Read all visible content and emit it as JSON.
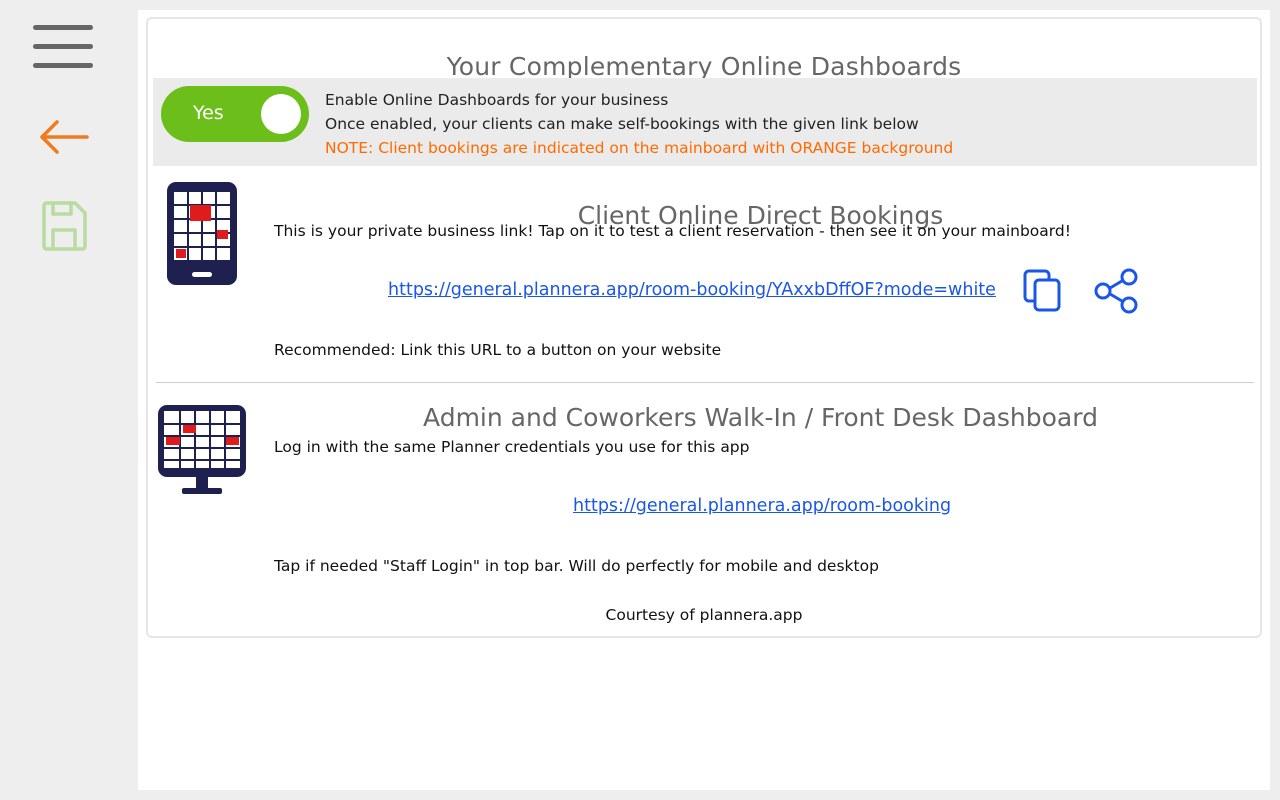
{
  "sidebar": {
    "menu_icon": "hamburger-menu-icon",
    "back_icon": "arrow-left-icon",
    "save_icon": "floppy-disk-icon"
  },
  "page": {
    "title": "Your Complementary Online Dashboards"
  },
  "enable": {
    "toggle_label": "Yes",
    "toggle_on": true,
    "line1": "Enable Online Dashboards for your business",
    "line2": "Once enabled, your clients can make self-bookings with the given link below",
    "note": "NOTE: Client bookings are indicated on the mainboard with ORANGE background"
  },
  "client": {
    "icon": "mobile-calendar-icon",
    "title": "Client Online Direct Bookings",
    "description": "This is your private business link! Tap on it to test a client reservation - then see it on your mainboard!",
    "link": "https://general.plannera.app/room-booking/YAxxbDffOF?mode=white",
    "copy_icon": "copy-icon",
    "share_icon": "share-icon",
    "recommendation": "Recommended: Link this URL to a button on your website"
  },
  "admin": {
    "icon": "desktop-calendar-icon",
    "title": "Admin and Coworkers Walk-In / Front Desk Dashboard",
    "description": "Log in with the same Planner credentials you use for this app",
    "link": "https://general.plannera.app/room-booking",
    "hint": "Tap if needed \"Staff Login\" in top bar. Will do perfectly for mobile and desktop"
  },
  "footer": "Courtesy of plannera.app",
  "colors": {
    "toggle_green": "#6cbf1b",
    "note_orange": "#ff6a00",
    "link_blue": "#1a56e8",
    "back_orange": "#f07a1e",
    "save_green": "#b8dca0",
    "navy": "#1e2150",
    "cell_red": "#e01b1b"
  }
}
